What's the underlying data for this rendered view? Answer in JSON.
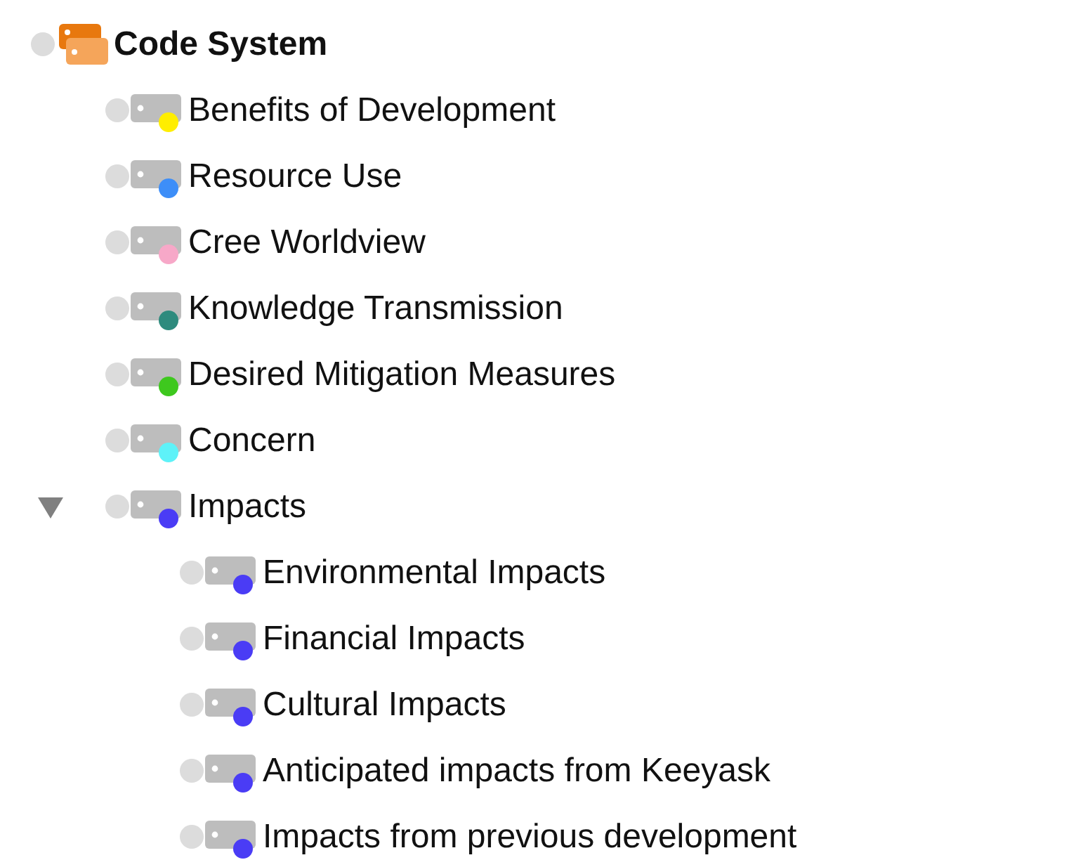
{
  "tree": {
    "label": "Code System",
    "children": [
      {
        "label": "Benefits of Development",
        "color": "#ffee00"
      },
      {
        "label": "Resource Use",
        "color": "#3d8ef8"
      },
      {
        "label": "Cree Worldview",
        "color": "#f7a8c8"
      },
      {
        "label": "Knowledge Transmission",
        "color": "#2e8b7e"
      },
      {
        "label": "Desired Mitigation Measures",
        "color": "#3ec81e"
      },
      {
        "label": "Concern",
        "color": "#5ef2f8"
      },
      {
        "label": "Impacts",
        "color": "#4a3cf5",
        "expanded": true,
        "children": [
          {
            "label": "Environmental Impacts",
            "color": "#4a3cf5"
          },
          {
            "label": "Financial Impacts",
            "color": "#4a3cf5"
          },
          {
            "label": "Cultural Impacts",
            "color": "#4a3cf5"
          },
          {
            "label": "Anticipated impacts from Keeyask",
            "color": "#4a3cf5"
          },
          {
            "label": "Impacts from previous development",
            "color": "#4a3cf5"
          }
        ]
      }
    ]
  }
}
